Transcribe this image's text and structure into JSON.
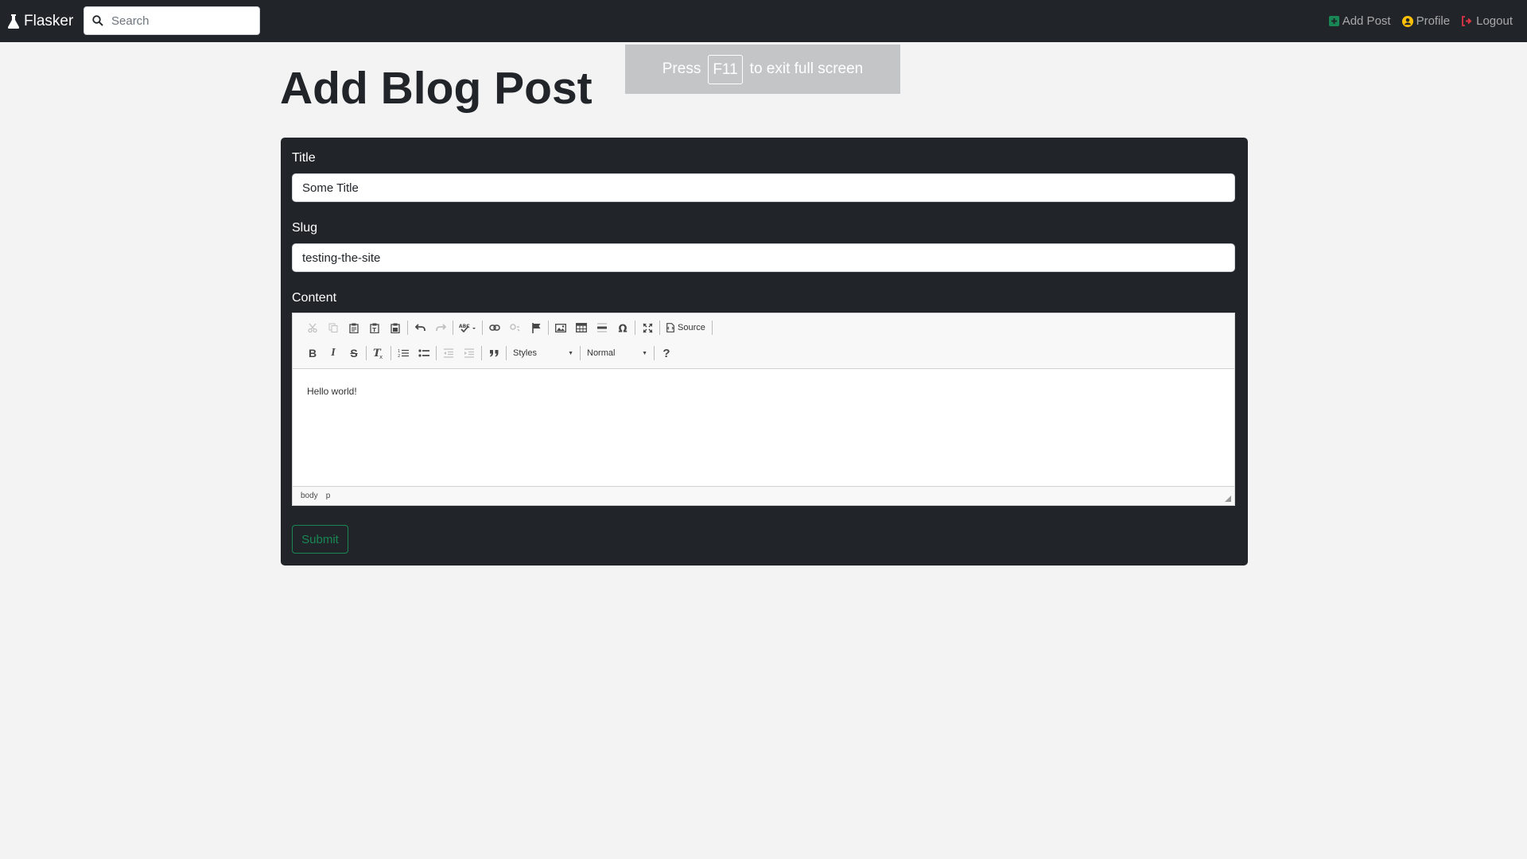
{
  "navbar": {
    "brand": "Flasker",
    "search_placeholder": "Search",
    "links": [
      {
        "label": "Add Post",
        "icon": "plus-square-icon",
        "color": "#198754"
      },
      {
        "label": "Profile",
        "icon": "user-circle-icon",
        "color": "#ffc107"
      },
      {
        "label": "Logout",
        "icon": "sign-out-icon",
        "color": "#dc3545"
      }
    ]
  },
  "fullscreen_notice": {
    "before": "Press",
    "key": "F11",
    "after": "to exit full screen"
  },
  "page": {
    "title": "Add Blog Post"
  },
  "form": {
    "title_label": "Title",
    "title_value": "Some Title",
    "slug_label": "Slug",
    "slug_value": "testing-the-site",
    "content_label": "Content",
    "submit_label": "Submit"
  },
  "editor": {
    "source_label": "Source",
    "styles_combo": "Styles",
    "format_combo": "Normal",
    "content_text": "Hello world!",
    "path": [
      "body",
      "p"
    ]
  },
  "colors": {
    "navbar_bg": "#212529",
    "card_bg": "#212529",
    "page_bg": "#f3f3f3",
    "submit_outline": "#198754"
  }
}
